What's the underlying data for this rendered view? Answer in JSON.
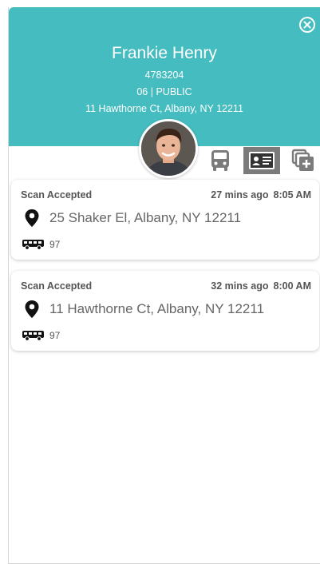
{
  "header": {
    "name": "Frankie Henry",
    "id_number": "4783204",
    "route_line": "06 | PUBLIC",
    "address": "11 Hawthorne Ct, Albany, NY 12211",
    "background_color": "#45bcbf"
  },
  "icons": {
    "close": "close-circle-icon",
    "avatar": "student-photo",
    "tab_bus": "bus-icon",
    "tab_id": "id-card-icon",
    "tab_multi": "add-multiple-icon",
    "location": "map-pin-icon",
    "route": "bus-icon"
  },
  "tabs": {
    "active": "id-card"
  },
  "scans": [
    {
      "status": "Scan Accepted",
      "ago": "27 mins ago",
      "time": "8:05 AM",
      "address": "25 Shaker El, Albany, NY 12211",
      "route": "97"
    },
    {
      "status": "Scan Accepted",
      "ago": "32 mins ago",
      "time": "8:00 AM",
      "address": "11 Hawthorne Ct, Albany, NY 12211",
      "route": "97"
    }
  ]
}
